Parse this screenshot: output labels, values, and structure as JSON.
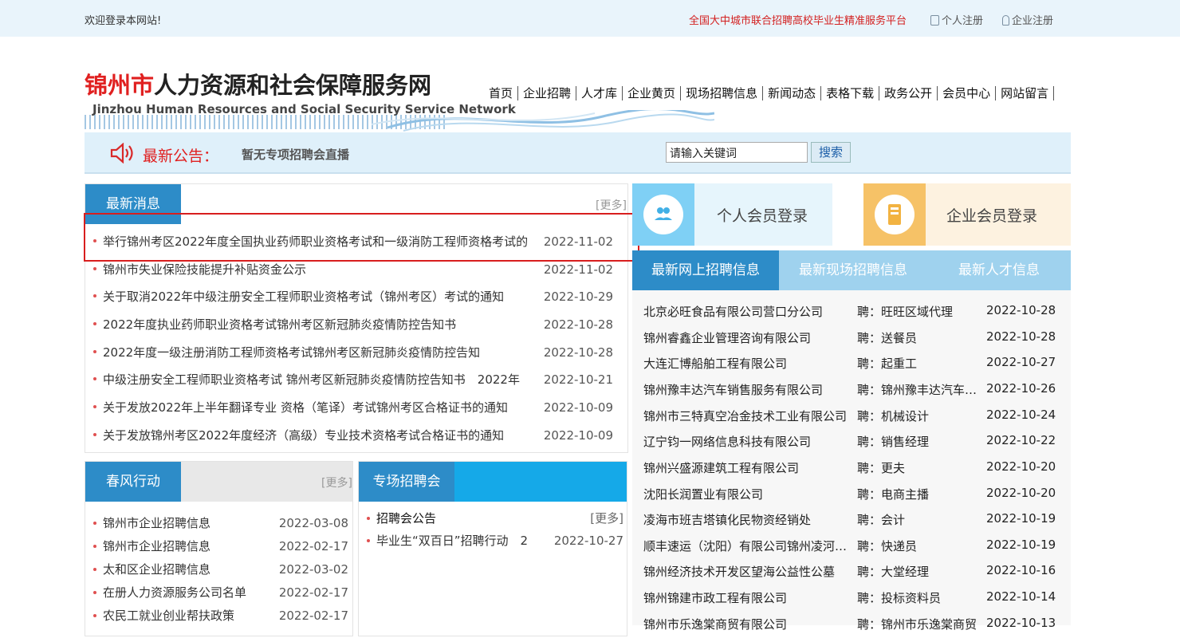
{
  "topbar": {
    "welcome": "欢迎登录本网站!",
    "platform": "全国大中城市联合招聘高校毕业生精准服务平台",
    "personal_register": "个人注册",
    "company_register": "企业注册"
  },
  "logo": {
    "city": "锦州市",
    "title": "人力资源和社会保障服务网",
    "english": "Jinzhou Human Resources and Social Security Service Network"
  },
  "nav": [
    "首页",
    "企业招聘",
    "人才库",
    "企业黄页",
    "现场招聘信息",
    "新闻动态",
    "表格下载",
    "政务公开",
    "会员中心",
    "网站留言"
  ],
  "notice": {
    "label": "最新公告：",
    "text": "暂无专项招聘会直播",
    "search_value": "请输入关键词",
    "search_button": "搜索"
  },
  "latest_news": {
    "title": "最新消息",
    "more": "[更多]",
    "items": [
      {
        "title": "举行锦州考区2022年度全国执业药师职业资格考试和一级消防工程师资格考试的",
        "date": "2022-11-02"
      },
      {
        "title": "锦州市失业保险技能提升补贴资金公示",
        "date": "2022-11-02"
      },
      {
        "title": "关于取消2022年中级注册安全工程师职业资格考试（锦州考区）考试的通知",
        "date": "2022-10-29"
      },
      {
        "title": "2022年度执业药师职业资格考试锦州考区新冠肺炎疫情防控告知书",
        "date": "2022-10-28"
      },
      {
        "title": "2022年度一级注册消防工程师资格考试锦州考区新冠肺炎疫情防控告知",
        "date": "2022-10-28"
      },
      {
        "title": "中级注册安全工程师职业资格考试 锦州考区新冠肺炎疫情防控告知书　2022年",
        "date": "2022-10-21"
      },
      {
        "title": "关于发放2022年上半年翻译专业 资格（笔译）考试锦州考区合格证书的通知",
        "date": "2022-10-09"
      },
      {
        "title": "关于发放锦州考区2022年度经济（高级）专业技术资格考试合格证书的通知",
        "date": "2022-10-09"
      }
    ]
  },
  "spring": {
    "title": "春风行动",
    "more": "[更多]",
    "items": [
      {
        "title": "锦州市企业招聘信息",
        "date": "2022-03-08"
      },
      {
        "title": "锦州市企业招聘信息",
        "date": "2022-02-17"
      },
      {
        "title": "太和区企业招聘信息",
        "date": "2022-03-02"
      },
      {
        "title": "在册人力资源服务公司名单",
        "date": "2022-02-17"
      },
      {
        "title": "农民工就业创业帮扶政策",
        "date": "2022-02-17"
      }
    ]
  },
  "special_fair": {
    "title": "专场招聘会",
    "sub_title": "招聘会公告",
    "more": "[更多]",
    "items": [
      {
        "title": "毕业生“双百日”招聘行动　2",
        "date": "2022-10-27"
      }
    ]
  },
  "login": {
    "personal": "个人会员登录",
    "company": "企业会员登录"
  },
  "job_tabs": [
    "最新网上招聘信息",
    "最新现场招聘信息",
    "最新人才信息"
  ],
  "jobs": [
    {
      "company": "北京必旺食品有限公司营口分公司",
      "position": "聘：旺旺区域代理",
      "date": "2022-10-28"
    },
    {
      "company": "锦州睿鑫企业管理咨询有限公司",
      "position": "聘：送餐员",
      "date": "2022-10-28"
    },
    {
      "company": "大连汇博船舶工程有限公司",
      "position": "聘：起重工",
      "date": "2022-10-27"
    },
    {
      "company": "锦州豫丰达汽车销售服务有限公司",
      "position": "聘：锦州豫丰达汽车销售",
      "date": "2022-10-26"
    },
    {
      "company": "锦州市三特真空冶金技术工业有限公司",
      "position": "聘：机械设计",
      "date": "2022-10-24"
    },
    {
      "company": "辽宁钧一网络信息科技有限公司",
      "position": "聘：销售经理",
      "date": "2022-10-22"
    },
    {
      "company": "锦州兴盛源建筑工程有限公司",
      "position": "聘：更夫",
      "date": "2022-10-20"
    },
    {
      "company": "沈阳长润置业有限公司",
      "position": "聘：电商主播",
      "date": "2022-10-20"
    },
    {
      "company": "凌海市班吉塔镇化民物资经销处",
      "position": "聘：会计",
      "date": "2022-10-19"
    },
    {
      "company": "顺丰速运（沈阳）有限公司锦州凌河分公司",
      "position": "聘：快递员",
      "date": "2022-10-19"
    },
    {
      "company": "锦州经济技术开发区望海公益性公墓",
      "position": "聘：大堂经理",
      "date": "2022-10-16"
    },
    {
      "company": "锦州锦建市政工程有限公司",
      "position": "聘：投标资料员",
      "date": "2022-10-14"
    },
    {
      "company": "锦州市乐逸棠商贸有限公司",
      "position": "聘：锦州市乐逸棠商贸",
      "date": "2022-10-13"
    }
  ]
}
